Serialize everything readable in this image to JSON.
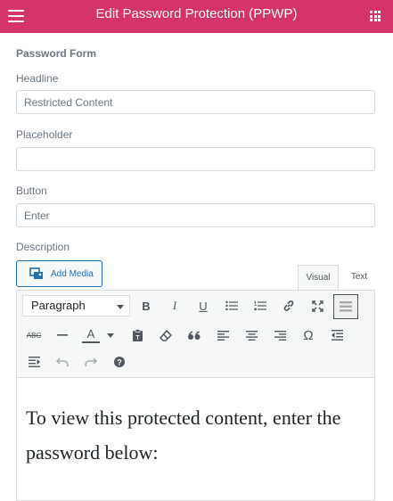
{
  "header": {
    "title": "Edit Password Protection (PPWP)",
    "menu_icon": "hamburger-icon",
    "apps_icon": "grid-icon",
    "bg_color": "#d5336b"
  },
  "form": {
    "section_title": "Password Form",
    "headline_label": "Headline",
    "headline_value": "Restricted Content",
    "placeholder_label": "Placeholder",
    "placeholder_value": "",
    "button_label": "Button",
    "button_value": "Enter",
    "description_label": "Description"
  },
  "editor": {
    "add_media_label": "Add Media",
    "tabs": {
      "visual": "Visual",
      "text": "Text"
    },
    "format_select": "Paragraph",
    "content": "To view this protected content, enter the password below:"
  }
}
